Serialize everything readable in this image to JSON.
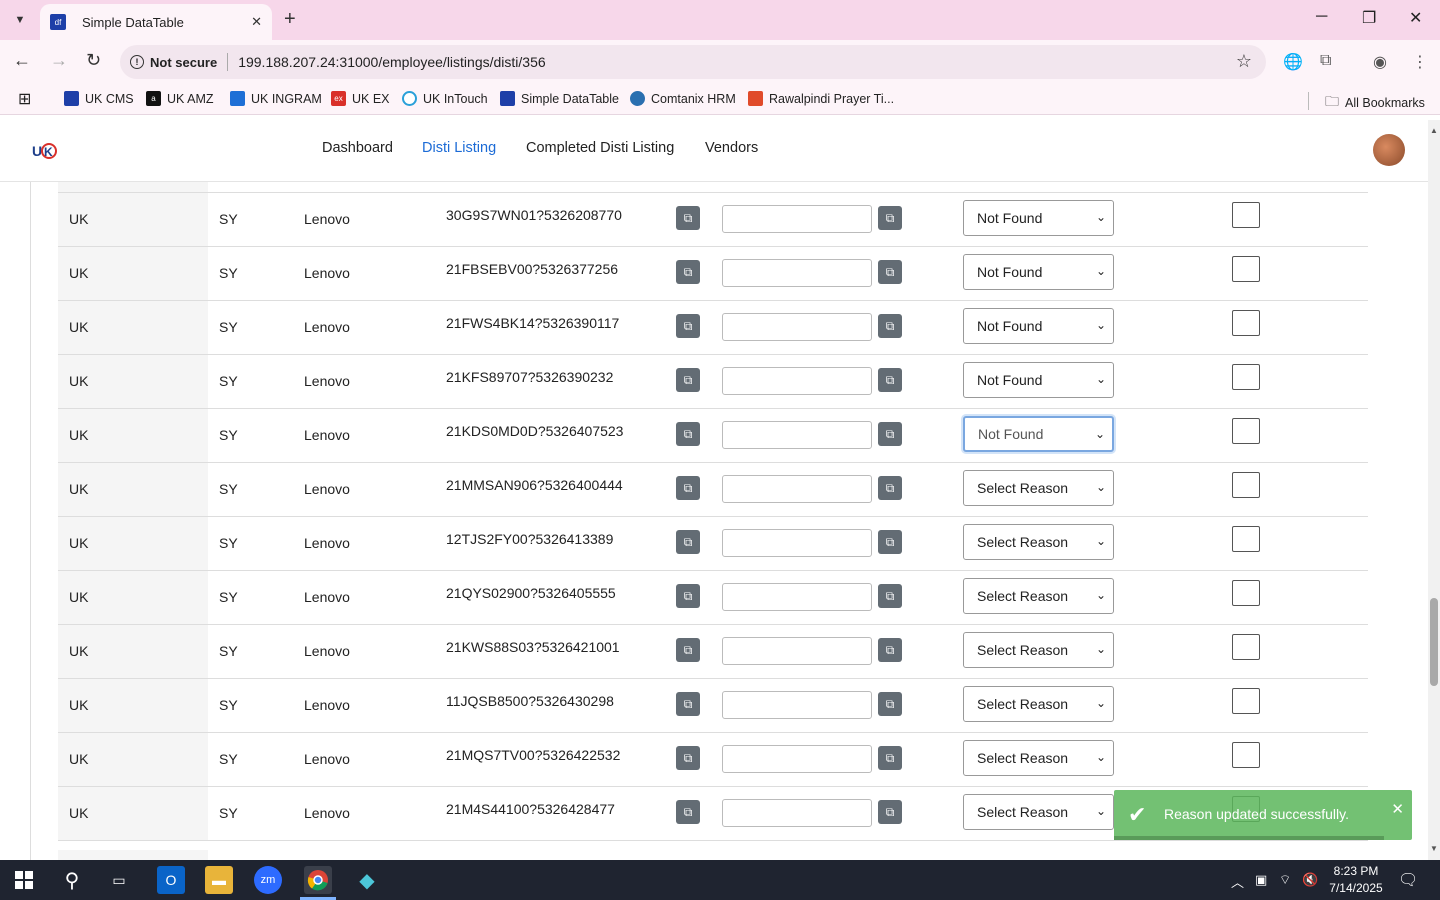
{
  "browser": {
    "tab_title": "Simple DataTable",
    "tab_favicon": "df",
    "new_tab": "+",
    "not_secure": "Not secure",
    "url": "199.188.207.24:31000/employee/listings/disti/356"
  },
  "bookmarks": [
    {
      "label": "UK CMS",
      "color": "#1e3fa8"
    },
    {
      "label": "UK AMZ",
      "color": "#111111"
    },
    {
      "label": "UK INGRAM",
      "color": "#1e6fd6"
    },
    {
      "label": "UK EX",
      "color": "#d9302a"
    },
    {
      "label": "UK InTouch",
      "color": "#2aa0d9"
    },
    {
      "label": "Simple DataTable",
      "color": "#1e3fa8"
    },
    {
      "label": "Comtanix HRM",
      "color": "#2a6fb0"
    },
    {
      "label": "Rawalpindi Prayer Ti...",
      "color": "#e04a2a"
    }
  ],
  "all_bookmarks": "All Bookmarks",
  "nav": {
    "dashboard": "Dashboard",
    "disti_listing": "Disti Listing",
    "completed_disti_listing": "Completed Disti Listing",
    "vendors": "Vendors"
  },
  "rows": [
    {
      "country": "UK",
      "code": "SY",
      "brand": "Lenovo",
      "sku": "30G9S7WN01?5326208770",
      "reason": "Not Found"
    },
    {
      "country": "UK",
      "code": "SY",
      "brand": "Lenovo",
      "sku": "21FBSEBV00?5326377256",
      "reason": "Not Found"
    },
    {
      "country": "UK",
      "code": "SY",
      "brand": "Lenovo",
      "sku": "21FWS4BK14?5326390117",
      "reason": "Not Found"
    },
    {
      "country": "UK",
      "code": "SY",
      "brand": "Lenovo",
      "sku": "21KFS89707?5326390232",
      "reason": "Not Found"
    },
    {
      "country": "UK",
      "code": "SY",
      "brand": "Lenovo",
      "sku": "21KDS0MD0D?5326407523",
      "reason": "Not Found"
    },
    {
      "country": "UK",
      "code": "SY",
      "brand": "Lenovo",
      "sku": "21MMSAN906?5326400444",
      "reason": "Select Reason"
    },
    {
      "country": "UK",
      "code": "SY",
      "brand": "Lenovo",
      "sku": "12TJS2FY00?5326413389",
      "reason": "Select Reason"
    },
    {
      "country": "UK",
      "code": "SY",
      "brand": "Lenovo",
      "sku": "21QYS02900?5326405555",
      "reason": "Select Reason"
    },
    {
      "country": "UK",
      "code": "SY",
      "brand": "Lenovo",
      "sku": "21KWS88S03?5326421001",
      "reason": "Select Reason"
    },
    {
      "country": "UK",
      "code": "SY",
      "brand": "Lenovo",
      "sku": "11JQSB8500?5326430298",
      "reason": "Select Reason"
    },
    {
      "country": "UK",
      "code": "SY",
      "brand": "Lenovo",
      "sku": "21MQS7TV00?5326422532",
      "reason": "Select Reason"
    },
    {
      "country": "UK",
      "code": "SY",
      "brand": "Lenovo",
      "sku": "21M4S44100?5326428477",
      "reason": "Select Reason"
    }
  ],
  "focused_row_index": 4,
  "toast": {
    "message": "Reason updated successfully.",
    "color": "#5bb75b"
  },
  "taskbar": {
    "time": "8:23 PM",
    "date": "7/14/2025"
  },
  "accent_color": "#1c6bd6"
}
